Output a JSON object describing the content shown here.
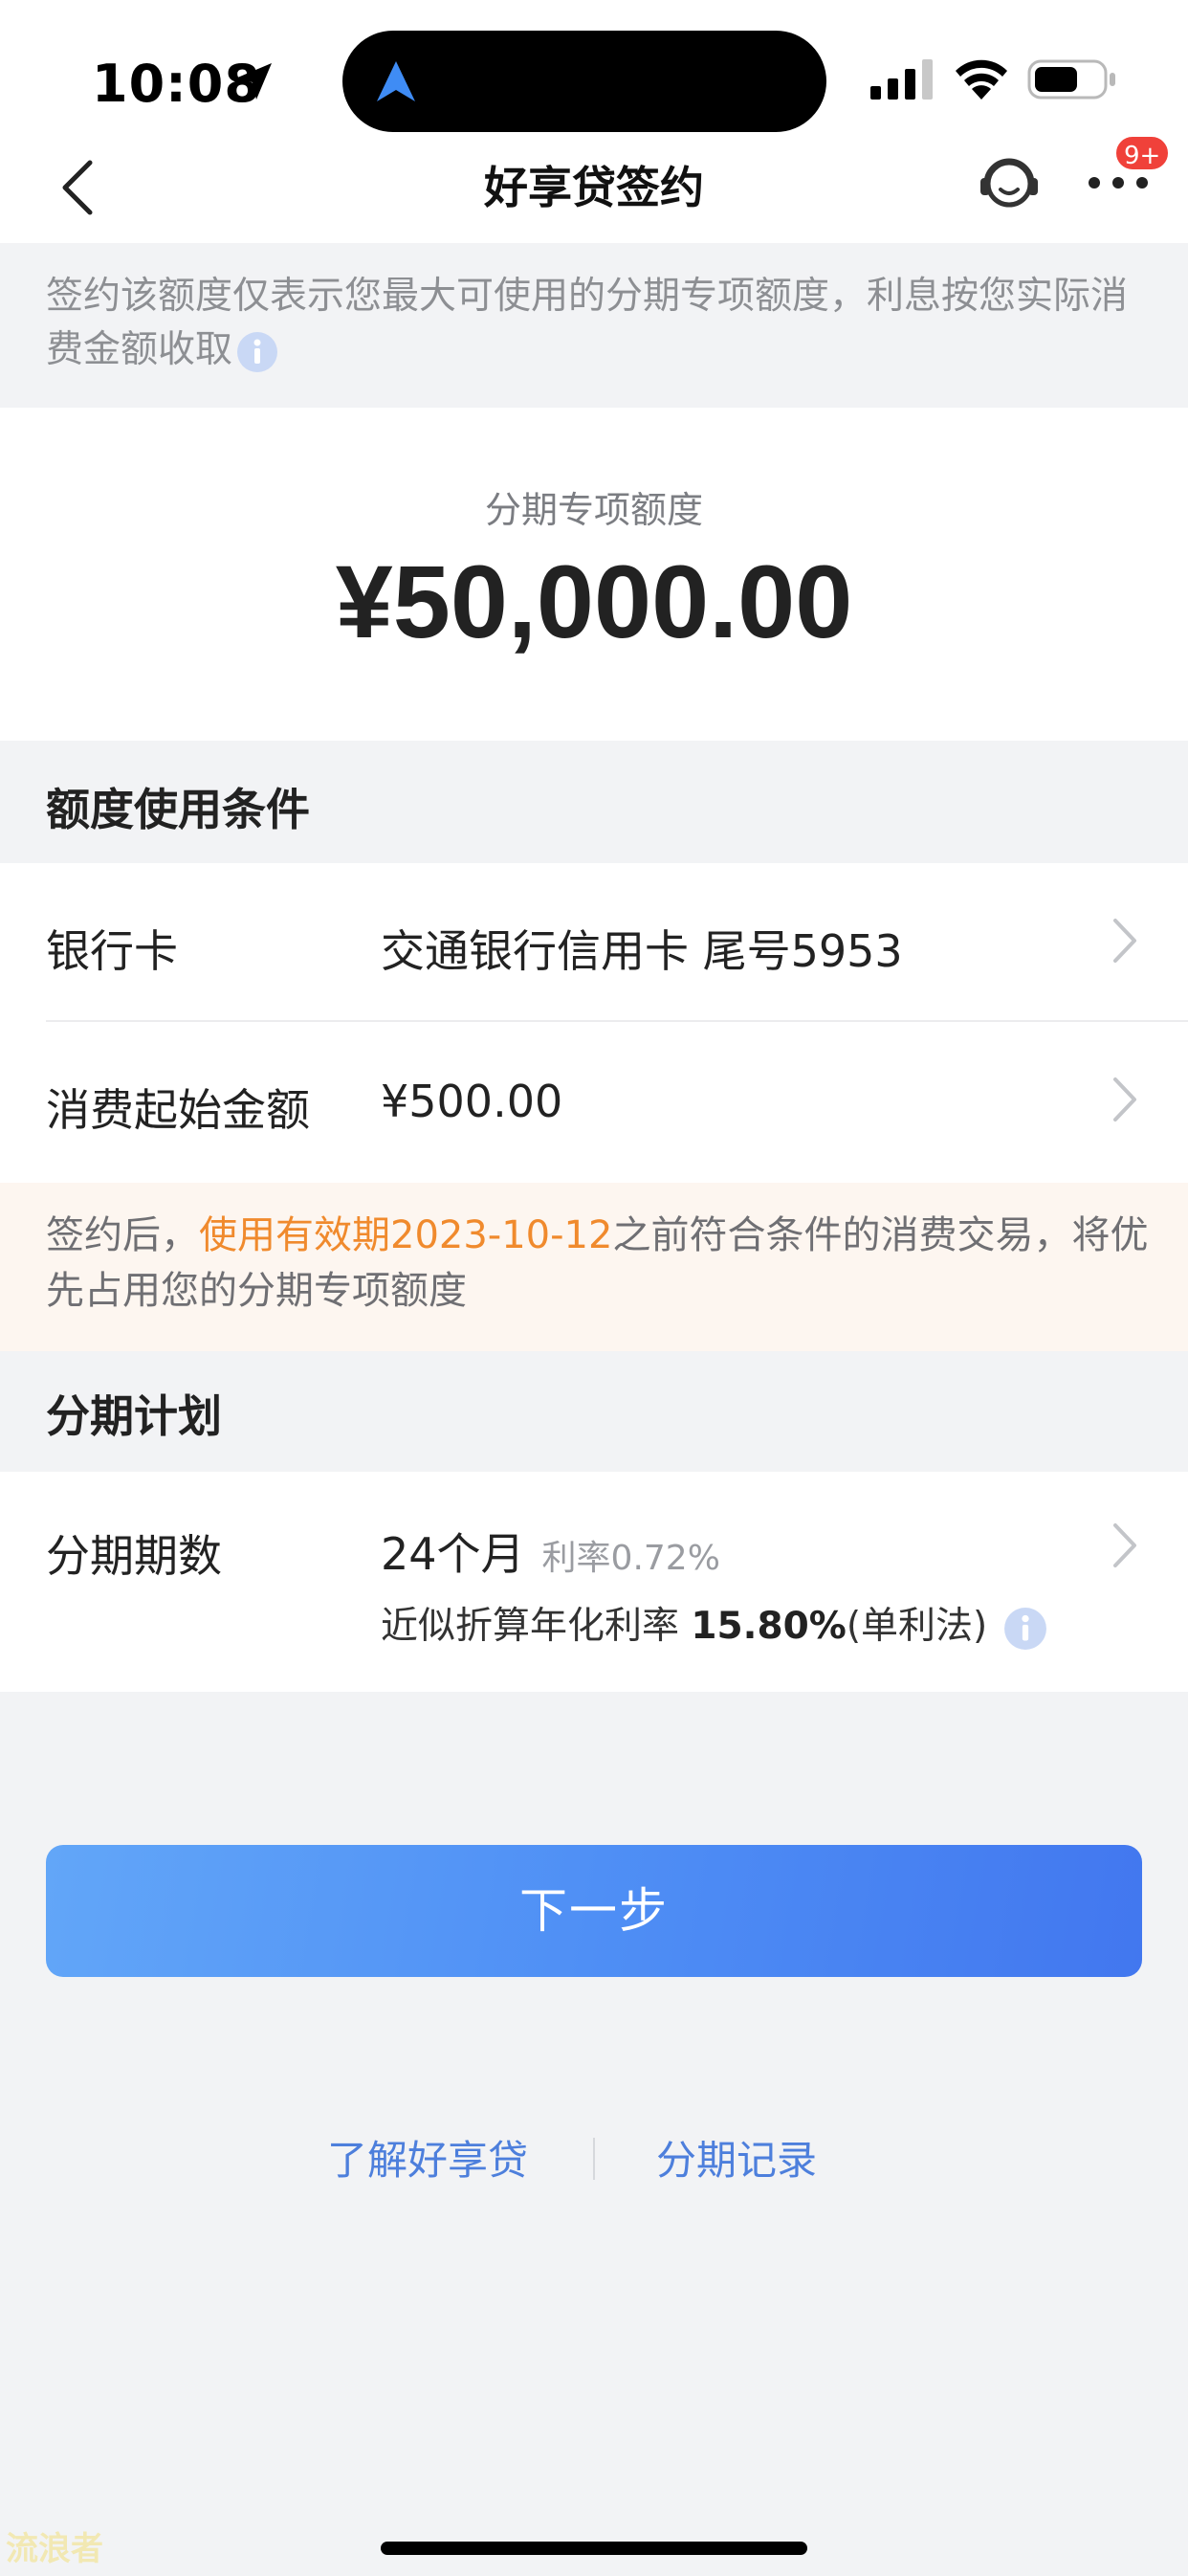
{
  "status_bar": {
    "time": "10:08",
    "icons": [
      "location-arrow-icon",
      "navigation-icon",
      "signal-icon",
      "wifi-icon",
      "battery-icon"
    ]
  },
  "header": {
    "title": "好享贷签约",
    "badge": "9+",
    "icons": [
      "back-icon",
      "customer-service-icon",
      "more-icon"
    ]
  },
  "notice": {
    "text": "签约该额度仅表示您最大可使用的分期专项额度，利息按您实际消费金额收取"
  },
  "amount": {
    "label": "分期专项额度",
    "value": "¥50,000.00"
  },
  "conditions": {
    "title": "额度使用条件",
    "bank_card_label": "银行卡",
    "bank_card_value": "交通银行信用卡 尾号5953",
    "min_amount_label": "消费起始金额",
    "min_amount_value": "¥500.00"
  },
  "tip": {
    "prefix": "签约后，",
    "highlight": "使用有效期2023-10-12",
    "suffix": "之前符合条件的消费交易，将优先占用您的分期专项额度"
  },
  "plan": {
    "title": "分期计划",
    "period_label": "分期期数",
    "period_value": "24个月",
    "rate_text": "利率0.72%",
    "apr_prefix": "近似折算年化利率 ",
    "apr_value": "15.80%",
    "apr_suffix": "(单利法)"
  },
  "actions": {
    "next_label": "下一步"
  },
  "links": {
    "learn_more": "了解好享贷",
    "records": "分期记录"
  },
  "watermark": "流浪者",
  "colors": {
    "accent": "#4f8ff5",
    "highlight": "#f08a2d",
    "badge": "#f0413a",
    "link": "#4d7fdc"
  }
}
